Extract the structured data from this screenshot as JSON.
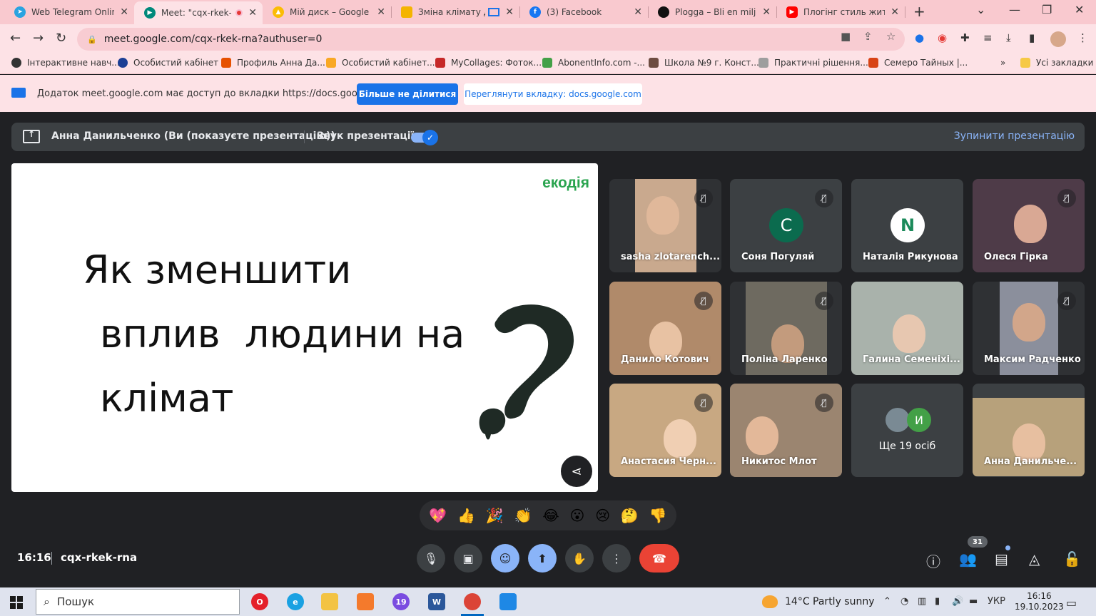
{
  "browser": {
    "tabs": [
      {
        "title": "Web Telegram Online",
        "color": "#2aa3e0",
        "active": false
      },
      {
        "title": "Meet: \"cqx-rkek-",
        "color": "#00897b",
        "active": true
      },
      {
        "title": "Мій диск – Google Д",
        "color": "#fbbc04",
        "active": false
      },
      {
        "title": "Зміна клімату Д",
        "color": "#f4b400",
        "active": false
      },
      {
        "title": "(3) Facebook",
        "color": "#1877f2",
        "active": false
      },
      {
        "title": "Plogga – Bli en miljö",
        "color": "#111111",
        "active": false
      },
      {
        "title": "Плогінг стиль життя",
        "color": "#ff0000",
        "active": false
      }
    ],
    "url": "meet.google.com/cqx-rkek-rna?authuser=0",
    "bookmarks": [
      {
        "label": "Інтерактивне навч...",
        "color": "#333333"
      },
      {
        "label": "Особистий кабінет",
        "color": "#1c3f95"
      },
      {
        "label": "Профиль Анна Да...",
        "color": "#e65100"
      },
      {
        "label": "Особистий кабінет...",
        "color": "#f9a825"
      },
      {
        "label": "MyCollages: Фоток...",
        "color": "#c62828"
      },
      {
        "label": "AbonentInfo.com -...",
        "color": "#43a047"
      },
      {
        "label": "Школа №9 г. Конст...",
        "color": "#6d4c41"
      },
      {
        "label": "Практичні рішення...",
        "color": "#9e9e9e"
      },
      {
        "label": "Семеро Тайных |...",
        "color": "#d84315"
      }
    ],
    "bookmarks_overflow": "»",
    "all_bookmarks": "Усі закладки"
  },
  "infobar": {
    "message": "Додаток meet.google.com має доступ до вкладки https://docs.google.com",
    "stop_sharing": "Більше не ділитися",
    "view_tab": "Переглянути вкладку: docs.google.com"
  },
  "presenting": {
    "who": "Анна Данильченко (Ви (показуєте презентацію))",
    "sound_label": "Звук презентації",
    "sound_on": true,
    "stop_label": "Зупинити презентацію"
  },
  "slide": {
    "brand": "екодія",
    "lines": [
      "Як зменшити",
      "вплив  людини на",
      "клімат"
    ]
  },
  "participants": [
    {
      "name": "sasha zlotarench...",
      "muted": true,
      "type": "video",
      "bg": "#c9a98e"
    },
    {
      "name": "Соня Погуляй",
      "muted": true,
      "type": "avatar",
      "initial": "С",
      "color": "#0b6b4e"
    },
    {
      "name": "Наталія Рикунова",
      "muted": false,
      "type": "avatar",
      "initial": "N",
      "color": "#ffffff"
    },
    {
      "name": "Олеся Гірка",
      "muted": true,
      "type": "video",
      "bg": "#4e3b48"
    },
    {
      "name": "Данило Котович",
      "muted": true,
      "type": "video",
      "bg": "#b08a6a"
    },
    {
      "name": "Поліна Ларенко",
      "muted": true,
      "type": "video",
      "bg": "#6e6a60"
    },
    {
      "name": "Галина Семеніхі...",
      "muted": false,
      "type": "video",
      "bg": "#a9b2ab"
    },
    {
      "name": "Максим Радченко",
      "muted": true,
      "type": "video",
      "bg": "#8b8f9c"
    },
    {
      "name": "Анастасия Черн...",
      "muted": true,
      "type": "video",
      "bg": "#c8a882"
    },
    {
      "name": "Никитос Млот",
      "muted": true,
      "type": "video",
      "bg": "#9b8570"
    },
    {
      "name": "Ще 19 осіб",
      "muted": false,
      "type": "more",
      "initial": "И",
      "color": "#43a047"
    },
    {
      "name": "Анна Данильче...",
      "muted": false,
      "type": "video",
      "bg": "#b7a17b"
    }
  ],
  "reactions": [
    "💖",
    "👍",
    "🎉",
    "👏",
    "😂",
    "😮",
    "😢",
    "🤔",
    "👎"
  ],
  "meeting": {
    "time": "16:16",
    "code": "cqx-rkek-rna",
    "people_count": "31"
  },
  "taskbar": {
    "search_placeholder": "Пошук",
    "weather": "14°C  Partly sunny",
    "lang": "УКР",
    "clock_time": "16:16",
    "clock_date": "19.10.2023"
  }
}
